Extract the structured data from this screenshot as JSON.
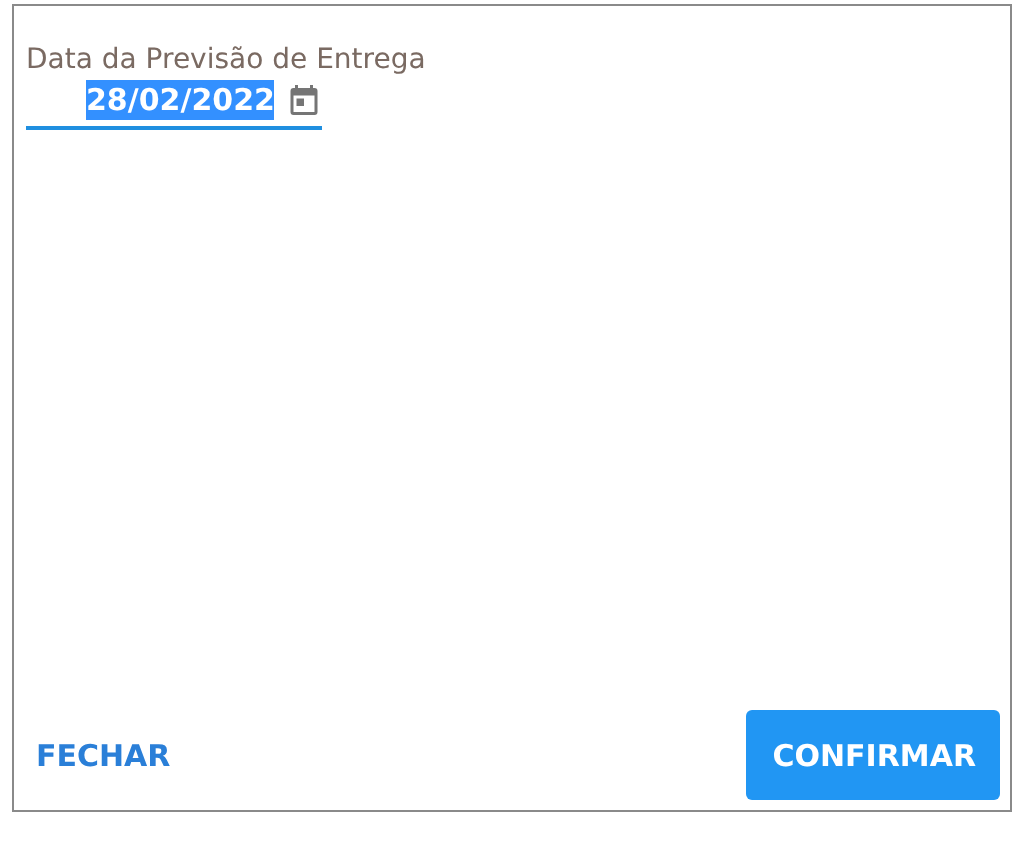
{
  "date_field": {
    "label": "Data da Previsão de Entrega",
    "value": "28/02/2022",
    "value_selected": true,
    "focused": true
  },
  "buttons": [
    {
      "label": "FECHAR",
      "kind": "text"
    },
    {
      "label": "CONFIRMAR",
      "kind": "contained"
    }
  ]
}
